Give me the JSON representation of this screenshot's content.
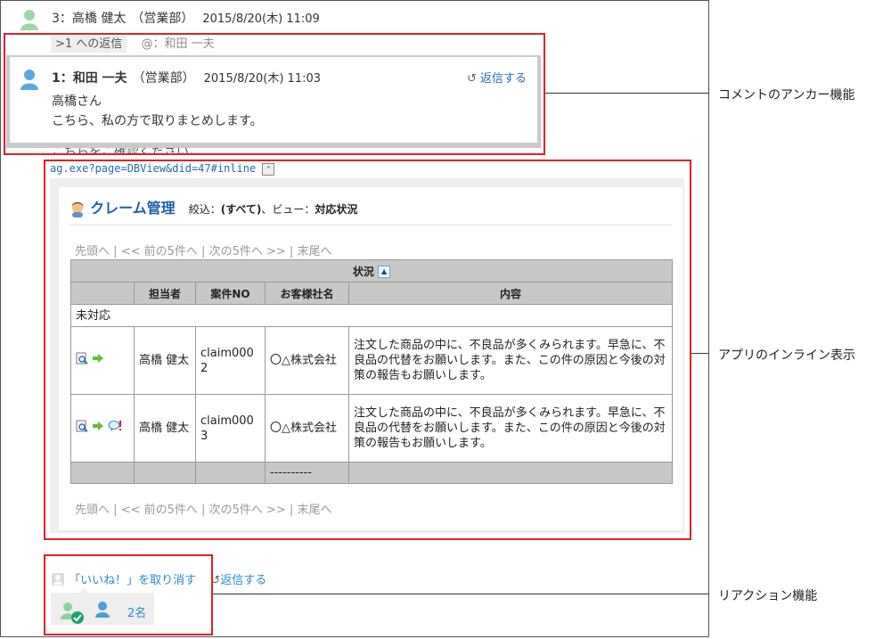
{
  "comment": {
    "author_line": "3：高橋 健太",
    "dept": "（営業部）",
    "date": "2015/8/20(木) 11:09",
    "anchor_link": ">1 への返信",
    "mention": "@：和田 一夫",
    "url": "ag.exe?page=DBView&did=47#inline"
  },
  "popup": {
    "author_line": "1：和田 一夫",
    "dept": "（営業部）",
    "date": "2015/8/20(木) 11:03",
    "reply": "返信する",
    "body_line1": "高橋さん",
    "body_line2": "こちら、私の方で取りまとめします。"
  },
  "app": {
    "title": "クレーム管理",
    "filter_label": "絞込：",
    "filter_value": "(すべて)",
    "view_label": "、ビュー：",
    "view_value": "対応状況",
    "pager": {
      "first": "先頭へ",
      "prev": "<< 前の5件へ",
      "next": "次の5件へ >>",
      "last": "末尾へ",
      "sep": "|"
    },
    "group_header": "状況",
    "columns": [
      "担当者",
      "案件NO",
      "お客様社名",
      "内容"
    ],
    "group_label": "未対応",
    "rows": [
      {
        "person": "高橋 健太",
        "case": "claim0002",
        "company": "〇△株式会社",
        "content": "注文した商品の中に、不良品が多くみられます。早急に、不良品の代替をお願いします。また、この件の原因と今後の対策の報告もお願いします。"
      },
      {
        "person": "高橋 健太",
        "case": "claim0003",
        "company": "〇△株式会社",
        "content": "注文した商品の中に、不良品が多くみられます。早急に、不良品の代替をお願いします。また、この件の原因と今後の対策の報告もお願いします。"
      }
    ],
    "footer_company": "----------"
  },
  "reaction": {
    "unlike": "「いいね！」を取り消す",
    "reply": "返信する",
    "count": "2名"
  },
  "callouts": {
    "anchor": "コメントのアンカー機能",
    "inline": "アプリのインライン表示",
    "reaction": "リアクション機能"
  },
  "colors": {
    "accent_red": "#e0202a",
    "link_blue": "#2a6ebb",
    "user_green": "#8fcf9a",
    "user_blue": "#4b9fd6"
  }
}
